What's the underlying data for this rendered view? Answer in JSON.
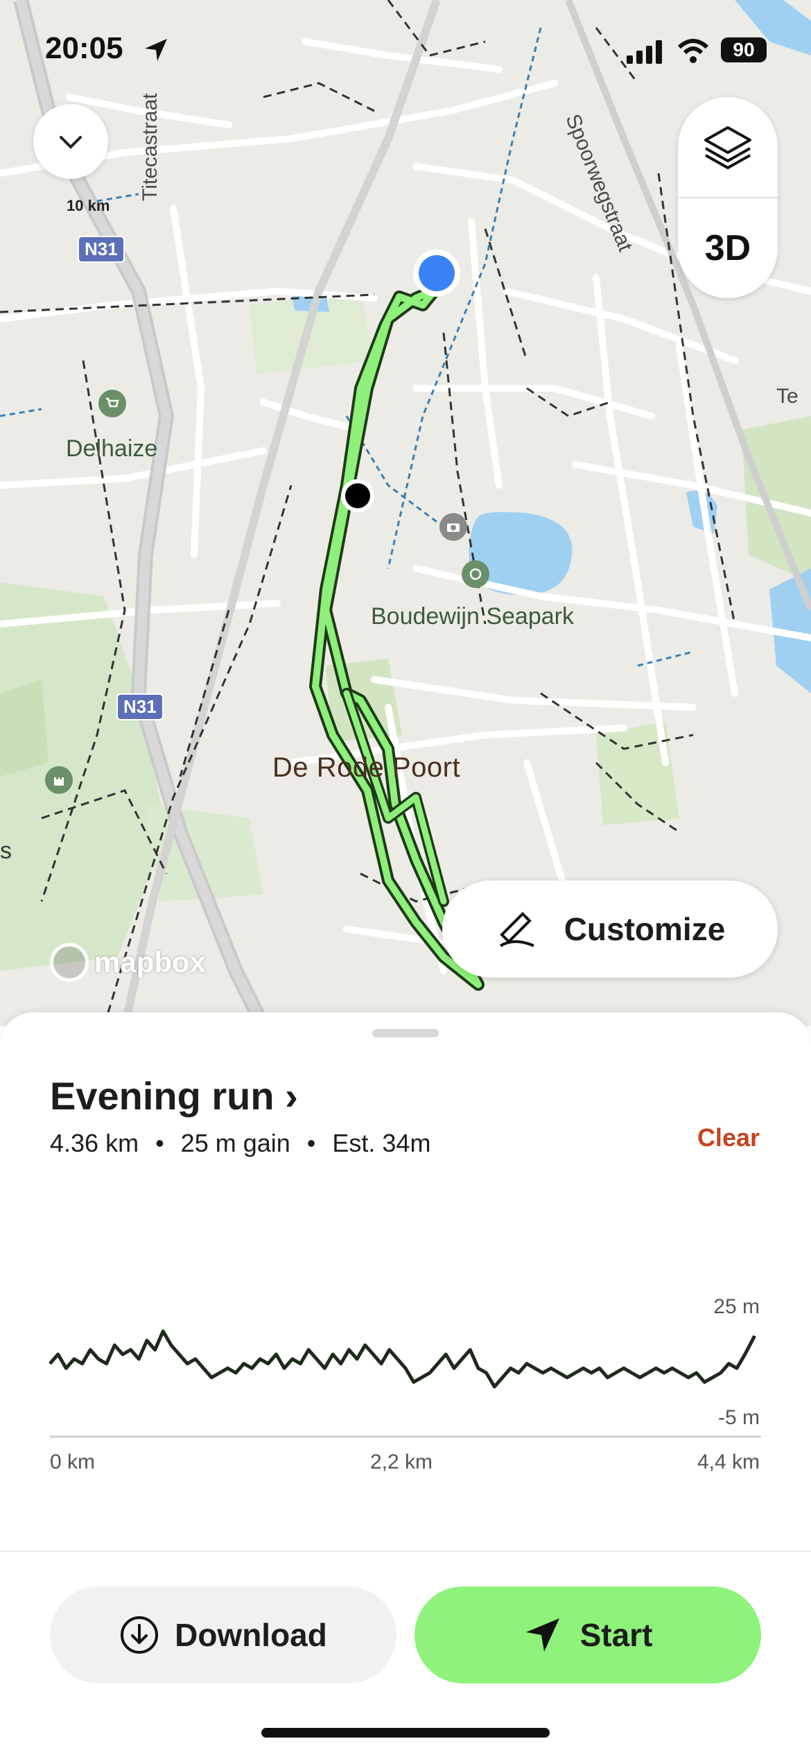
{
  "status_bar": {
    "time": "20:05",
    "battery": "90"
  },
  "map": {
    "streets": [
      "Titecastraat",
      "Spoorwegstraat",
      "Te"
    ],
    "places": [
      "Delhaize",
      "Boudewijn Seapark",
      "De Rode Poort",
      "s"
    ],
    "road_shields": [
      "N31",
      "N31"
    ],
    "scale": "10 km",
    "attribution": "mapbox",
    "buttons": {
      "three_d": "3D",
      "customize": "Customize"
    },
    "route_color": "#8ef07a",
    "user_location_color": "#3b82f6"
  },
  "route": {
    "title": "Evening run",
    "chevron": "›",
    "distance": "4.36 km",
    "gain": "25 m gain",
    "estimate": "Est. 34m",
    "separator": "•",
    "clear_label": "Clear"
  },
  "chart_data": {
    "type": "line",
    "title": "",
    "xlabel": "",
    "ylabel": "",
    "x_ticks": [
      "0 km",
      "2,2 km",
      "4,4 km"
    ],
    "y_ticks": [
      "25 m",
      "-5 m"
    ],
    "xlim": [
      0,
      4.4
    ],
    "ylim": [
      -5,
      25
    ],
    "series": [
      {
        "x": [
          0,
          0.05,
          0.1,
          0.15,
          0.2,
          0.25,
          0.3,
          0.35,
          0.4,
          0.45,
          0.5,
          0.55,
          0.6,
          0.65,
          0.7,
          0.75,
          0.8,
          0.85,
          0.9,
          0.95,
          1.0,
          1.05,
          1.1,
          1.15,
          1.2,
          1.25,
          1.3,
          1.35,
          1.4,
          1.45,
          1.5,
          1.55,
          1.6,
          1.65,
          1.7,
          1.75,
          1.8,
          1.85,
          1.9,
          1.95,
          2.0,
          2.05,
          2.1,
          2.15,
          2.2,
          2.25,
          2.3,
          2.35,
          2.4,
          2.45,
          2.5,
          2.55,
          2.6,
          2.65,
          2.7,
          2.75,
          2.8,
          2.85,
          2.9,
          2.95,
          3.0,
          3.05,
          3.1,
          3.15,
          3.2,
          3.25,
          3.3,
          3.35,
          3.4,
          3.45,
          3.5,
          3.55,
          3.6,
          3.65,
          3.7,
          3.75,
          3.8,
          3.85,
          3.9,
          3.95,
          4.0,
          4.05,
          4.1,
          4.15,
          4.2,
          4.25,
          4.3,
          4.36
        ],
        "y": [
          9,
          11,
          8,
          10,
          9,
          12,
          10,
          9,
          13,
          11,
          12,
          10,
          14,
          12,
          16,
          13,
          11,
          9,
          10,
          8,
          6,
          7,
          8,
          7,
          9,
          8,
          10,
          9,
          11,
          8,
          10,
          9,
          12,
          10,
          8,
          11,
          9,
          12,
          10,
          13,
          11,
          9,
          12,
          10,
          8,
          5,
          6,
          7,
          9,
          11,
          8,
          10,
          12,
          8,
          7,
          4,
          6,
          8,
          7,
          9,
          8,
          7,
          8,
          7,
          6,
          7,
          8,
          7,
          8,
          6,
          7,
          8,
          7,
          6,
          7,
          8,
          7,
          8,
          7,
          6,
          7,
          5,
          6,
          7,
          9,
          8,
          11,
          15
        ]
      }
    ]
  },
  "actions": {
    "download_label": "Download",
    "start_label": "Start"
  }
}
